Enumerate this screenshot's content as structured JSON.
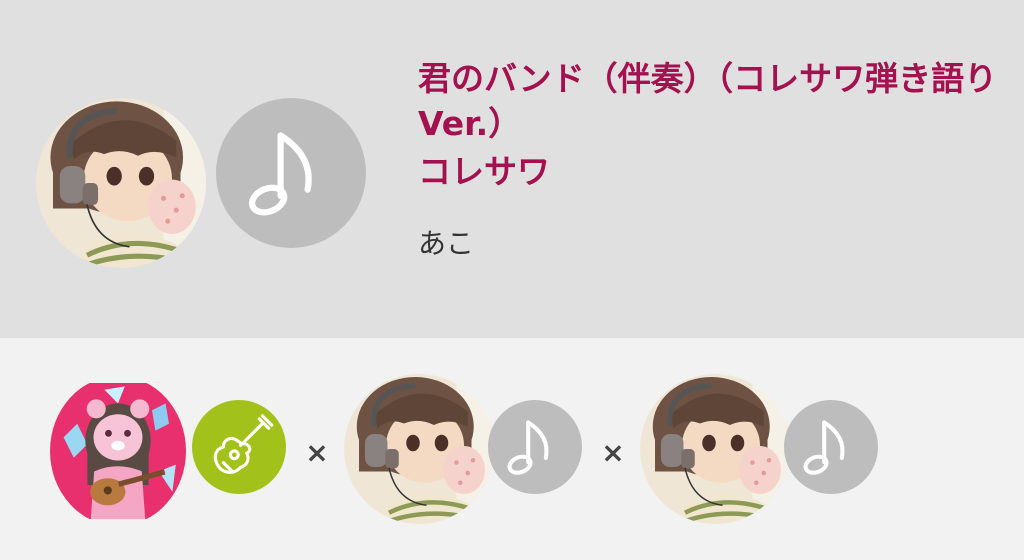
{
  "song": {
    "title": "君のバンド（伴奏）（コレサワ弾き語りVer.）",
    "artist": "コレサワ"
  },
  "recording": {
    "singer_name": "あこ"
  },
  "collaboration": {
    "separator": "×",
    "participants": [
      {
        "avatar": "pink-bear-guitar-girl-avatar",
        "part_icon": "guitar-icon",
        "part_color": "#a3c11b"
      },
      {
        "avatar": "headphones-girl-avatar",
        "part_icon": "music-note-icon",
        "part_color": "#bdbdbd"
      },
      {
        "avatar": "headphones-girl-avatar",
        "part_icon": "music-note-icon",
        "part_color": "#bdbdbd"
      }
    ]
  },
  "colors": {
    "title_accent": "#a3114f",
    "header_bg": "#e0e0e0",
    "collab_bg": "#f2f2f2",
    "vocal_badge": "#bdbdbd",
    "guitar_badge": "#a3c11b"
  }
}
